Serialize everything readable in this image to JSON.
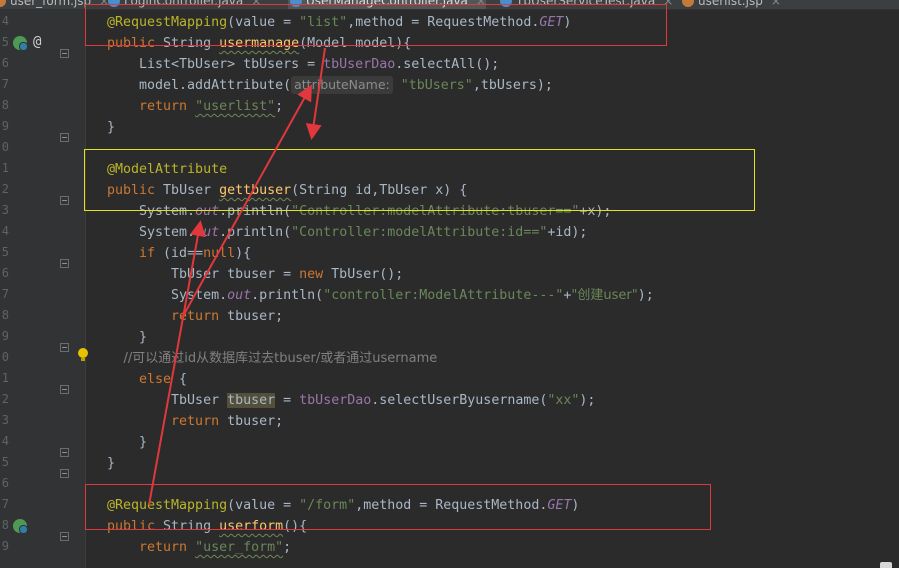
{
  "tabs": [
    {
      "label": "user_form.jsp",
      "color": "#c47a3a",
      "active": false
    },
    {
      "label": "LoginController.java",
      "color": "#4a8ecb",
      "active": false
    },
    {
      "label": "UserManageController.java",
      "color": "#4a8ecb",
      "active": true
    },
    {
      "label": "TbUserServiceTest.java",
      "color": "#4a8ecb",
      "active": false
    },
    {
      "label": "userlist.jsp",
      "color": "#c47a3a",
      "active": false
    }
  ],
  "tab_close": "×",
  "gutter": {
    "line_numbers": [
      "4",
      "5",
      "6",
      "7",
      "8",
      "9",
      "0",
      "1",
      "2",
      "3",
      "4",
      "5",
      "6",
      "7",
      "8",
      "9",
      "0",
      "1",
      "2",
      "3",
      "4",
      "5",
      "6",
      "7",
      "8",
      "9"
    ],
    "at_symbol": "@",
    "icons": [
      "run-config-icon",
      "run-config-icon",
      "lightbulb-icon"
    ]
  },
  "code": {
    "l1": {
      "ann": "@RequestMapping",
      "a": "(value = ",
      "s1": "\"list\"",
      "b": ",method = RequestMethod.",
      "c": "GET",
      "d": ")"
    },
    "l2": {
      "kw": "public",
      "a": " String ",
      "fn": "usermanage",
      "b": "(Model model){"
    },
    "l3": {
      "a": "    List<TbUser> tbUsers = ",
      "f": "tbUserDao",
      "b": ".selectAll();"
    },
    "l4": {
      "a": "    model.addAttribute(",
      "hint": "attributeName:",
      "s": "\"tbUsers\"",
      "b": ",tbUsers);"
    },
    "l5": {
      "kw": "    return ",
      "s": "\"userlist\"",
      "b": ";"
    },
    "l6": {
      "a": "}"
    },
    "l8": {
      "ann": "@ModelAttribute"
    },
    "l9": {
      "kw": "public",
      "a": " TbUser ",
      "fn": "gettbuser",
      "b": "(String id,TbUser x) {"
    },
    "l10": {
      "a": "    System.",
      "f": "out",
      "b": ".println(",
      "s": "\"Controller:modelAttribute:tbuser==\"",
      "c": "+x);"
    },
    "l11": {
      "a": "    System.",
      "f": "out",
      "b": ".println(",
      "s": "\"Controller:modelAttribute:id==\"",
      "c": "+id);"
    },
    "l12": {
      "kw": "    if ",
      "a": "(id==",
      "kw2": "null",
      "b": "){"
    },
    "l13": {
      "a": "        TbUser tbuser = ",
      "kw": "new",
      "b": " TbUser();"
    },
    "l14": {
      "a": "        System.",
      "f": "out",
      "b": ".println(",
      "s": "\"controller:ModelAttribute---\"",
      "c": "+",
      "s2": "\"创建user\"",
      "d": ");"
    },
    "l15": {
      "kw": "        return",
      "a": " tbuser;"
    },
    "l16": {
      "a": "    }"
    },
    "l17": {
      "cmt": "    //可以通过id从数据库过去tbuser/或者通过username"
    },
    "l18": {
      "kw": "    else",
      "a": " {"
    },
    "l19": {
      "a": "        TbUser ",
      "h": "tbuser",
      "b": " = ",
      "f": "tbUserDao",
      "c": ".selectUserByusername(",
      "s": "\"xx\"",
      "d": ");"
    },
    "l20": {
      "kw": "        return",
      "a": " tbuser;"
    },
    "l21": {
      "a": "    }"
    },
    "l22": {
      "a": "}"
    },
    "l24": {
      "ann": "@RequestMapping",
      "a": "(value = ",
      "s": "\"/form\"",
      "b": ",method = RequestMethod.",
      "c": "GET",
      "d": ")"
    },
    "l25": {
      "kw": "public",
      "a": " String ",
      "fn": "userform",
      "b": "(){"
    },
    "l26": {
      "kw": "    return ",
      "s": "\"user_form\"",
      "b": ";"
    }
  },
  "colors": {
    "annotation_red": "#e0383c",
    "annotation_yellow": "#e6e21a"
  }
}
